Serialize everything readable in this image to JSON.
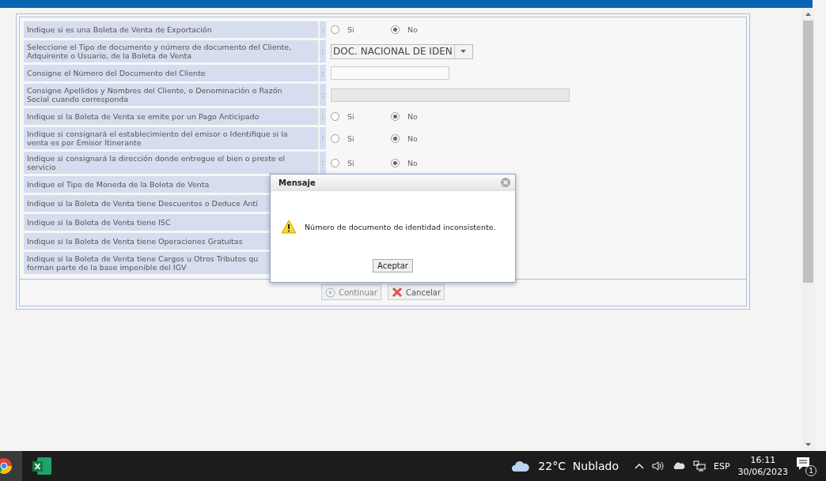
{
  "form": {
    "rows": [
      {
        "label": "Indique si es una Boleta de Venta de Exportación",
        "colon": ":",
        "kind": "radio",
        "options": [
          {
            "label": "Si",
            "selected": false
          },
          {
            "label": "No",
            "selected": true
          }
        ]
      },
      {
        "label": "Seleccione el Tipo de documento y número de documento del Cliente, Adquirente o Usuario, de la Boleta de Venta",
        "colon": ":",
        "kind": "select",
        "value": "DOC. NACIONAL DE IDEN"
      },
      {
        "label": "Consigne el Número del Documento del Cliente",
        "colon": ":",
        "kind": "input",
        "disabled": false
      },
      {
        "label": "Consigne Apellidos y Nombres del Cliente, o Denominación o Razón Social cuando corresponda",
        "colon": ":",
        "kind": "input",
        "disabled": true
      },
      {
        "label": "Indique si la Boleta de Venta se emite por un Pago Anticipado",
        "colon": ":",
        "kind": "radio",
        "options": [
          {
            "label": "Si",
            "selected": false
          },
          {
            "label": "No",
            "selected": true
          }
        ]
      },
      {
        "label": "Indique si consignará el establecimiento del emisor o Identifique si la venta es por Emisor Itinerante",
        "colon": ":",
        "kind": "radio",
        "options": [
          {
            "label": "Si",
            "selected": false
          },
          {
            "label": "No",
            "selected": true
          }
        ]
      },
      {
        "label": "Indique si consignará la dirección donde entregue el bien o preste el servicio",
        "colon": ":",
        "kind": "radio",
        "options": [
          {
            "label": "Si",
            "selected": false
          },
          {
            "label": "No",
            "selected": true
          }
        ]
      },
      {
        "label": "Indique el Tipo de Moneda de la Boleta de Venta",
        "kind": "covered"
      },
      {
        "label": "Indique si la Boleta de Venta tiene Descuentos o Deduce Anti",
        "kind": "covered"
      },
      {
        "label": "Indique si la Boleta de Venta tiene ISC",
        "kind": "covered"
      },
      {
        "label": "Indique si la Boleta de Venta tiene Operaciones Gratuitas",
        "kind": "covered"
      },
      {
        "label": "Indique si la Boleta de Venta tiene Cargos u Otros Tributos qu\nforman parte de la base imponible del IGV",
        "kind": "covered"
      }
    ],
    "buttons": [
      {
        "label": "Continuar",
        "kind": "continue",
        "disabled": true
      },
      {
        "label": "Cancelar",
        "kind": "cancel",
        "disabled": false
      }
    ]
  },
  "dialog": {
    "title": "Mensaje",
    "message": "Número de documento de identidad inconsistente.",
    "button": "Aceptar"
  },
  "taskbar": {
    "weather": "22°C  Nublado",
    "language": "ESP",
    "time": "16:11",
    "date": "30/06/2023",
    "notifications": "1"
  }
}
